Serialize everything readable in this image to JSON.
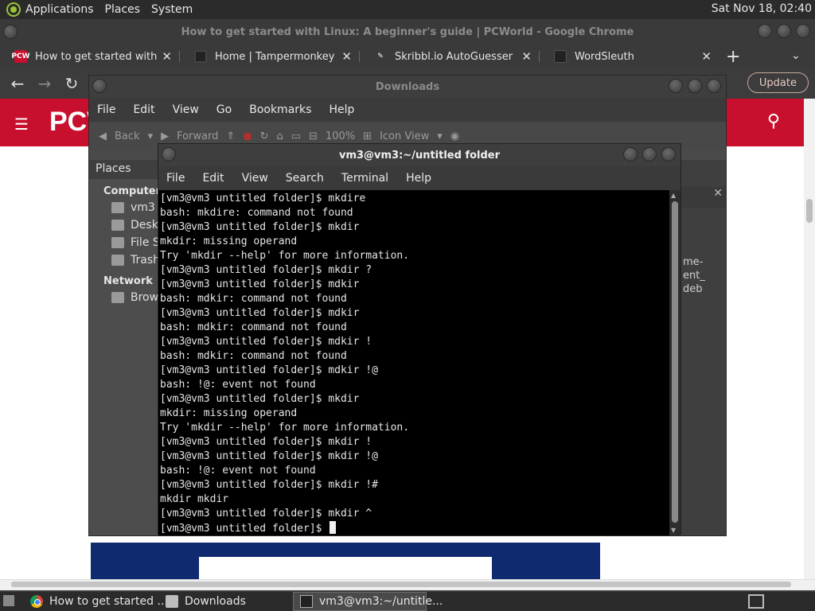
{
  "top_panel": {
    "menus": [
      "Applications",
      "Places",
      "System"
    ],
    "clock": "Sat Nov 18, 02:40"
  },
  "chrome": {
    "window_title": "How to get started with Linux: A beginner's guide | PCWorld - Google Chrome",
    "tabs": [
      {
        "favicon": "pcw-favicon",
        "favicon_text": "PCW",
        "title": "How to get started with Linux: A beginner's guide | PCWorld",
        "active": true
      },
      {
        "favicon": "tampermonkey-favicon",
        "title": "Home | Tampermonkey"
      },
      {
        "favicon": "skribbl-favicon",
        "title": "Skribbl.io AutoGuesser"
      },
      {
        "favicon": "wordsleuth-favicon",
        "title": "WordSleuth"
      }
    ],
    "new_tab_label": "+",
    "update_label": "Update",
    "page": {
      "logo": "PCW",
      "accent": "#c8102e"
    }
  },
  "file_manager": {
    "title": "Downloads",
    "menu": [
      "File",
      "Edit",
      "View",
      "Go",
      "Bookmarks",
      "Help"
    ],
    "toolbar": {
      "back": "Back",
      "forward": "Forward",
      "zoom": "100%",
      "view_mode": "Icon View"
    },
    "sidebar": {
      "header": "Places",
      "groups": [
        {
          "label": "Computer",
          "items": [
            "vm3",
            "Deskt",
            "File Sy",
            "Trash"
          ]
        },
        {
          "label": "Network",
          "items": [
            "Brows"
          ]
        }
      ]
    },
    "main_partial_text": [
      "me-",
      "ent_",
      "deb"
    ]
  },
  "terminal": {
    "title": "vm3@vm3:~/untitled folder",
    "menu": [
      "File",
      "Edit",
      "View",
      "Search",
      "Terminal",
      "Help"
    ],
    "lines": [
      "[vm3@vm3 untitled folder]$ mkdire",
      "bash: mkdire: command not found",
      "[vm3@vm3 untitled folder]$ mkdir",
      "mkdir: missing operand",
      "Try 'mkdir --help' for more information.",
      "[vm3@vm3 untitled folder]$ mkdir ?",
      "[vm3@vm3 untitled folder]$ mdkir",
      "bash: mdkir: command not found",
      "[vm3@vm3 untitled folder]$ mdkir",
      "bash: mdkir: command not found",
      "[vm3@vm3 untitled folder]$ mdkir !",
      "bash: mdkir: command not found",
      "[vm3@vm3 untitled folder]$ mdkir !@",
      "bash: !@: event not found",
      "[vm3@vm3 untitled folder]$ mkdir",
      "mkdir: missing operand",
      "Try 'mkdir --help' for more information.",
      "[vm3@vm3 untitled folder]$ mkdir !",
      "[vm3@vm3 untitled folder]$ mkdir !@",
      "bash: !@: event not found",
      "[vm3@vm3 untitled folder]$ mkdir !#",
      "mkdir mkdir",
      "[vm3@vm3 untitled folder]$ mkdir ^",
      "[vm3@vm3 untitled folder]$ "
    ]
  },
  "taskbar": {
    "tasks": [
      {
        "icon": "chrome-icon",
        "label": "How to get started ..."
      },
      {
        "icon": "folder-icon",
        "label": "Downloads"
      },
      {
        "icon": "terminal-icon",
        "label": "vm3@vm3:~/untitle...",
        "active": true
      }
    ]
  }
}
